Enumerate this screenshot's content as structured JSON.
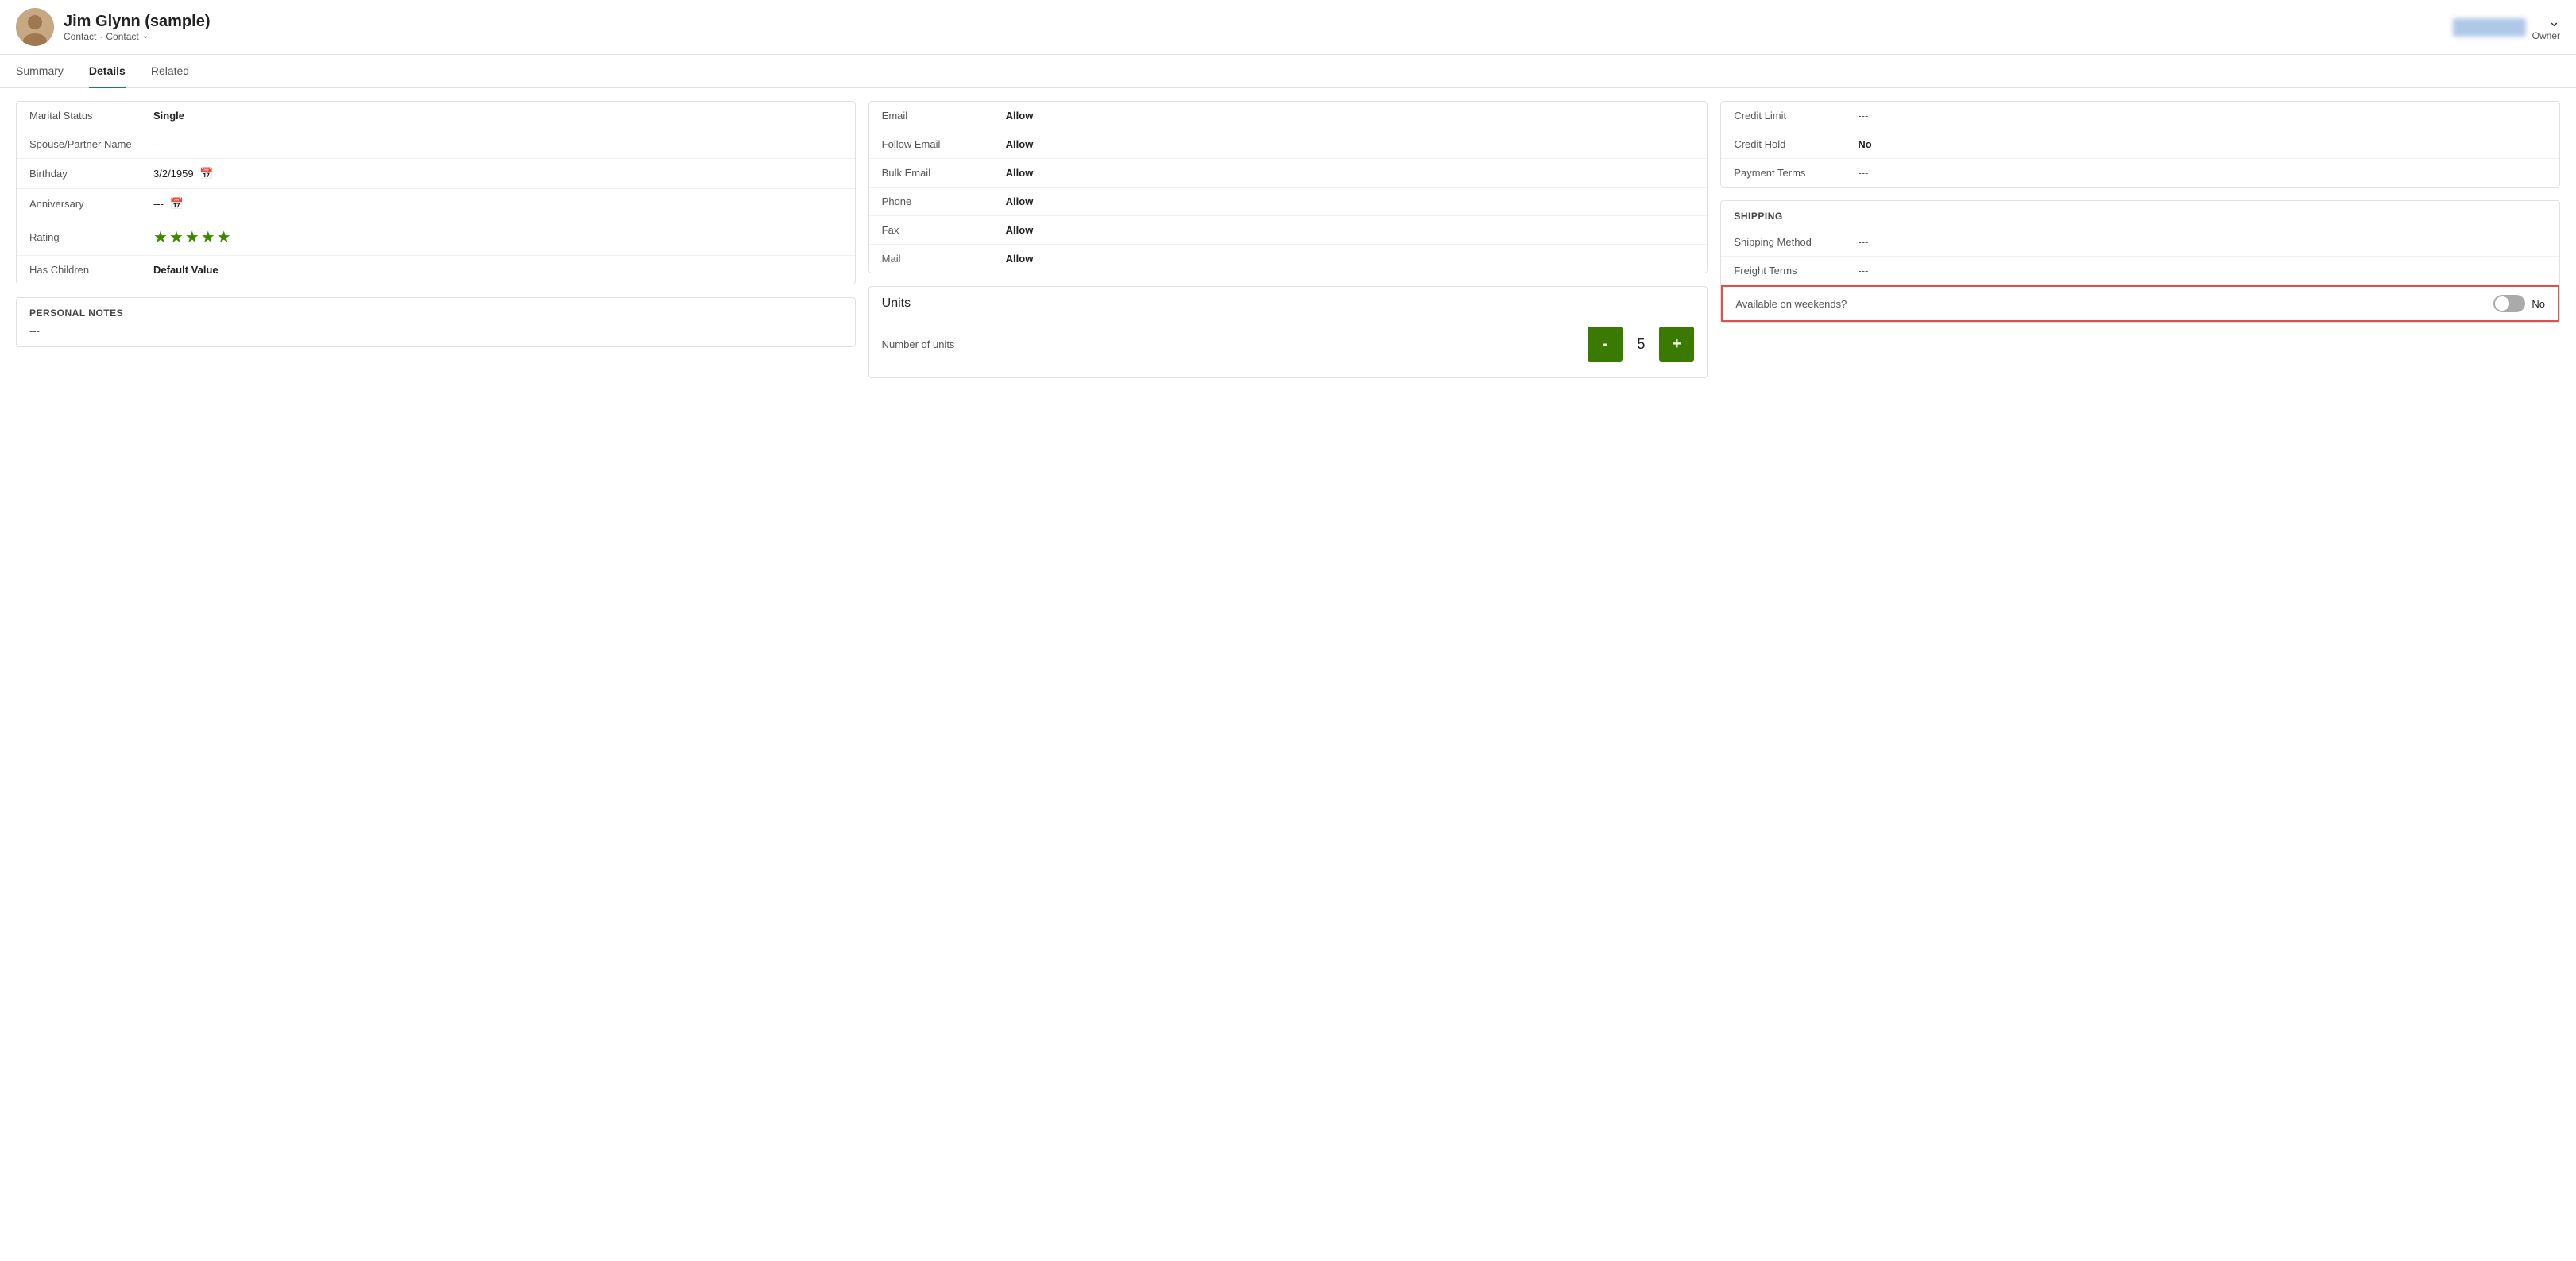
{
  "header": {
    "name": "Jim Glynn (sample)",
    "subtitle1": "Contact",
    "subtitle2": "Contact",
    "owner_label": "Owner",
    "blurred_btn": "Help Docs"
  },
  "nav": {
    "tabs": [
      {
        "label": "Summary",
        "active": false
      },
      {
        "label": "Details",
        "active": true
      },
      {
        "label": "Related",
        "active": false
      }
    ]
  },
  "personal_info": {
    "section_fields": [
      {
        "label": "Marital Status",
        "value": "Single",
        "bold": true,
        "has_cal": false
      },
      {
        "label": "Spouse/Partner Name",
        "value": "---",
        "bold": false,
        "has_cal": false
      },
      {
        "label": "Birthday",
        "value": "3/2/1959",
        "bold": false,
        "has_cal": true
      },
      {
        "label": "Anniversary",
        "value": "---",
        "bold": false,
        "has_cal": true
      },
      {
        "label": "Has Children",
        "value": "Default Value",
        "bold": true,
        "has_cal": false
      }
    ],
    "rating_label": "Rating",
    "rating_stars": 5
  },
  "personal_notes": {
    "title": "PERSONAL NOTES",
    "content": "---"
  },
  "contact_prefs": {
    "fields": [
      {
        "label": "Email",
        "value": "Allow"
      },
      {
        "label": "Follow Email",
        "value": "Allow"
      },
      {
        "label": "Bulk Email",
        "value": "Allow"
      },
      {
        "label": "Phone",
        "value": "Allow"
      },
      {
        "label": "Fax",
        "value": "Allow"
      },
      {
        "label": "Mail",
        "value": "Allow"
      }
    ]
  },
  "units": {
    "title": "Units",
    "number_of_units_label": "Number of units",
    "value": "5",
    "minus_label": "-",
    "plus_label": "+"
  },
  "credit": {
    "fields": [
      {
        "label": "Credit Limit",
        "value": "---",
        "bold": false
      },
      {
        "label": "Credit Hold",
        "value": "No",
        "bold": true
      },
      {
        "label": "Payment Terms",
        "value": "---",
        "bold": false
      }
    ]
  },
  "shipping": {
    "title": "SHIPPING",
    "fields": [
      {
        "label": "Shipping Method",
        "value": "---"
      },
      {
        "label": "Freight Terms",
        "value": "---"
      }
    ],
    "weekends_label": "Available on weekends?",
    "weekends_value": "No"
  }
}
